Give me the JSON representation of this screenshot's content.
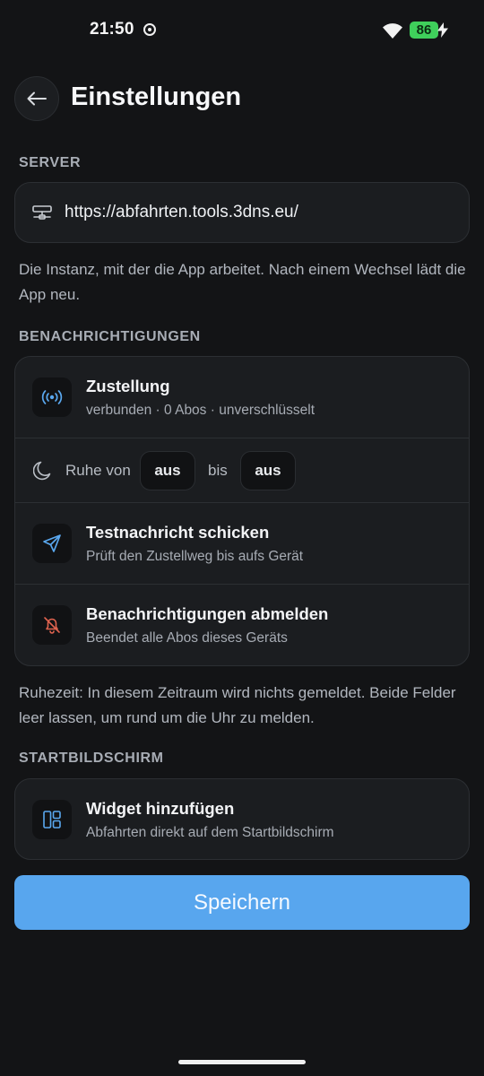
{
  "status_bar": {
    "time": "21:50",
    "battery": "86",
    "icons": [
      "record-icon",
      "wifi-icon",
      "battery-icon",
      "charging-bolt-icon"
    ]
  },
  "header": {
    "title": "Einstellungen",
    "back_icon": "arrow-left-icon"
  },
  "server": {
    "section_label": "SERVER",
    "icon": "server-icon",
    "url": "https://abfahrten.tools.3dns.eu/",
    "help": "Die Instanz, mit der die App arbeitet. Nach einem Wechsel lädt die App neu."
  },
  "notifications": {
    "section_label": "BENACHRICHTIGUNGEN",
    "delivery": {
      "icon": "broadcast-icon",
      "title": "Zustellung",
      "subtitle": "verbunden · 0 Abos · unverschlüsselt"
    },
    "quiet_hours": {
      "icon": "moon-icon",
      "from_label": "Ruhe von",
      "from_value": "aus",
      "to_label": "bis",
      "to_value": "aus"
    },
    "test": {
      "icon": "send-icon",
      "title": "Testnachricht schicken",
      "subtitle": "Prüft den Zustellweg bis aufs Gerät"
    },
    "unsubscribe": {
      "icon": "bell-off-icon",
      "title": "Benachrichtigungen abmelden",
      "subtitle": "Beendet alle Abos dieses Geräts"
    },
    "help": "Ruhezeit: In diesem Zeitraum wird nichts gemeldet. Beide Felder leer lassen, um rund um die Uhr zu melden."
  },
  "home_screen": {
    "section_label": "STARTBILDSCHIRM",
    "widget": {
      "icon": "layout-icon",
      "title": "Widget hinzufügen",
      "subtitle": "Abfahrten direkt auf dem Startbildschirm"
    }
  },
  "save_button": "Speichern",
  "colors": {
    "background": "#131416",
    "card": "#1b1d20",
    "accent_blue": "#58a6ee",
    "danger_red": "#e0634f",
    "battery_green": "#3fcf5b"
  }
}
